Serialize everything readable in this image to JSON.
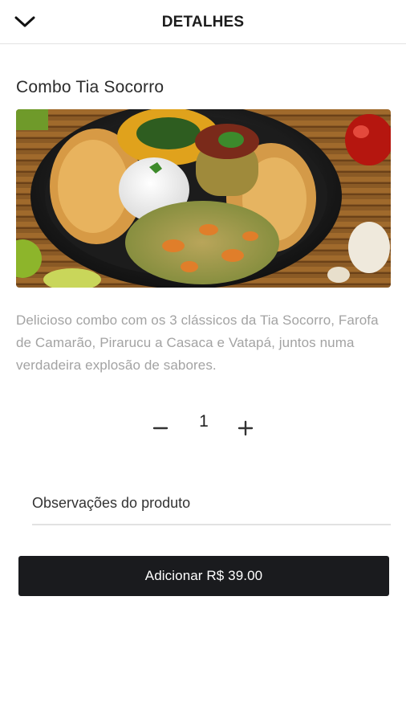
{
  "header": {
    "title": "DETALHES",
    "back_icon": "chevron-down-icon"
  },
  "product": {
    "name": "Combo Tia Socorro",
    "image": "food-photo",
    "description": "Delicioso combo com os 3 clássicos da Tia Socorro, Farofa de Camarão, Pirarucu a Casaca e Vatapá, juntos numa verdadeira explosão de sabores."
  },
  "quantity": {
    "value": "1",
    "minus_icon": "minus-icon",
    "plus_icon": "plus-icon"
  },
  "notes": {
    "placeholder": "Observações do produto",
    "value": ""
  },
  "add_button": {
    "label": "Adicionar R$ 39.00"
  },
  "colors": {
    "button_bg": "#1a1b1e",
    "description_text": "#a3a3a3",
    "divider": "#e3e3e3"
  }
}
